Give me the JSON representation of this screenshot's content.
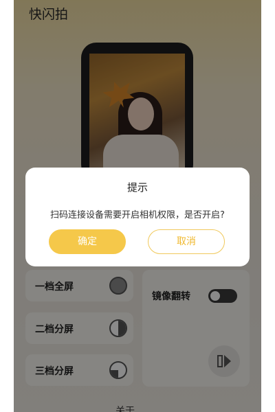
{
  "app": {
    "title": "快闪拍"
  },
  "modes": [
    {
      "label": "一档全屏",
      "icon": "circle-full-icon"
    },
    {
      "label": "二档分屏",
      "icon": "circle-half-icon"
    },
    {
      "label": "三档分屏",
      "icon": "circle-quarter-icon"
    }
  ],
  "mirror": {
    "label": "镜像翻转",
    "toggle_on": false,
    "button_icon": "flip-icon"
  },
  "footer": {
    "about_label": "关于"
  },
  "dialog": {
    "title": "提示",
    "message": "扫码连接设备需要开启相机权限，是否开启?",
    "confirm_label": "确定",
    "cancel_label": "取消"
  },
  "colors": {
    "accent": "#f5c84a",
    "accent_text": "#f0b92f"
  }
}
